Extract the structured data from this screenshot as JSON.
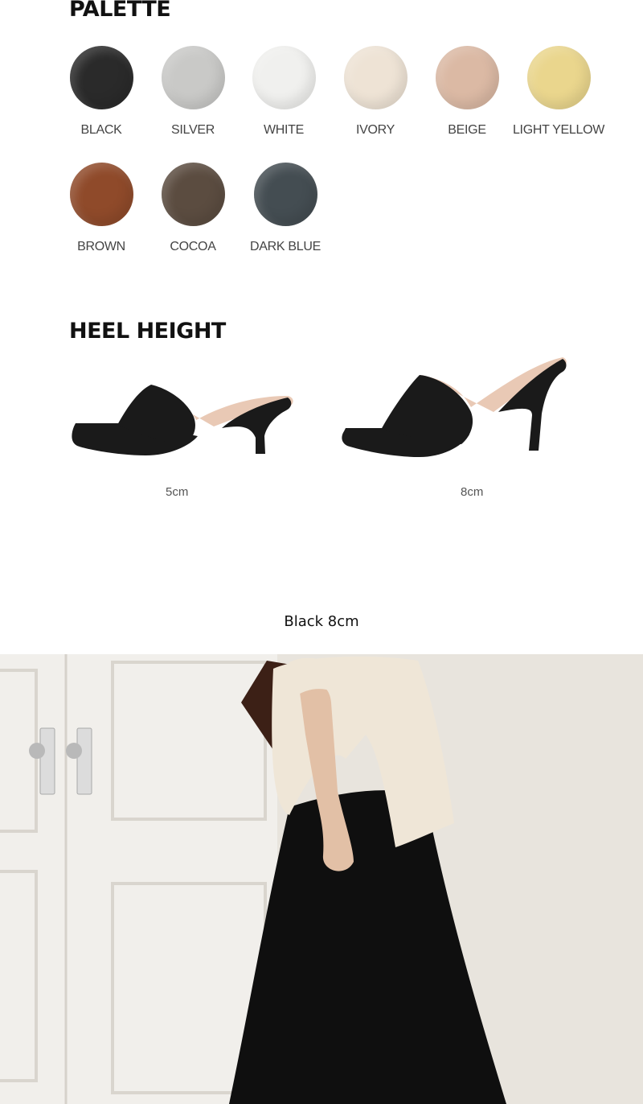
{
  "palette": {
    "title": "PALETTE",
    "colors": [
      {
        "label": "BLACK",
        "color": "#2a2a2a"
      },
      {
        "label": "SILVER",
        "color": "#c9c9c7"
      },
      {
        "label": "WHITE",
        "color": "#f0f0ee"
      },
      {
        "label": "IVORY",
        "color": "#eee3d5"
      },
      {
        "label": "BEIGE",
        "color": "#dbb9a4"
      },
      {
        "label": "LIGHT YELLOW",
        "color": "#ead68d"
      },
      {
        "label": "BROWN",
        "color": "#8f4a2a"
      },
      {
        "label": "COCOA",
        "color": "#5b4c40"
      },
      {
        "label": "DARK BLUE",
        "color": "#444d52"
      }
    ]
  },
  "heel_height": {
    "title": "HEEL HEIGHT",
    "options": [
      {
        "label": "5cm",
        "shoe_color": "#1a1a1a",
        "lining_color": "#e9c9b5"
      },
      {
        "label": "8cm",
        "shoe_color": "#1a1a1a",
        "lining_color": "#e9c9b5"
      }
    ]
  },
  "photo": {
    "caption": "Black 8cm",
    "colors": {
      "wall": "#e8e4dd",
      "door": "#f1efeb",
      "shirt": "#efe6d7",
      "skirt": "#0f0f0f",
      "bag": "#3c2016",
      "skin": "#e2c0a6"
    }
  }
}
